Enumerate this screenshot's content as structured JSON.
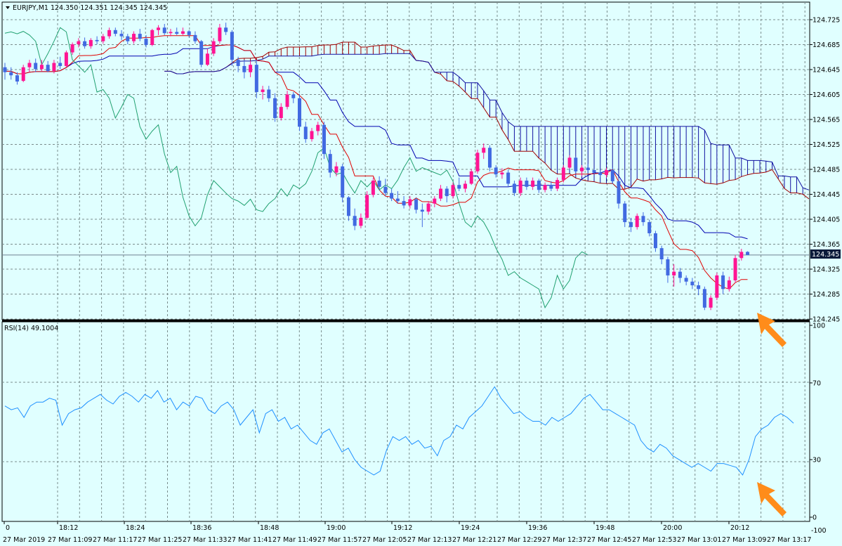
{
  "colors": {
    "background": "#e0ffff",
    "grid": "#7a8c8c",
    "bull": "#ff1493",
    "bear": "#4169e1",
    "tenkan": "#e00000",
    "kijun": "#0000b0",
    "chikou": "#20a070",
    "cloud_bull": "#a00000",
    "cloud_bear": "#1010a0",
    "rsi": "#1e90ff",
    "arrow": "#ff8c1a",
    "bid_line": "#708090"
  },
  "main_chart": {
    "header": "EURJPY,M1  124.350 124.351 124.345 124.345",
    "current_price_label": "124.345",
    "price_ticks": [
      "124.725",
      "124.685",
      "124.645",
      "124.605",
      "124.565",
      "124.525",
      "124.485",
      "124.445",
      "124.405",
      "124.365",
      "124.325",
      "124.285",
      "124.245"
    ]
  },
  "rsi_panel": {
    "header": "RSI(14) 49.1004",
    "levels": [
      "100",
      "70",
      "30",
      "0"
    ],
    "bottom_label": "-100"
  },
  "time_axis": {
    "upper_labels": [
      "0",
      "18:12",
      "18:24",
      "18:36",
      "18:48",
      "19:00",
      "19:12",
      "19:24",
      "19:36",
      "19:48",
      "20:00",
      "20:12"
    ],
    "lower_labels": [
      "27 Mar 2019",
      "27 Mar 11:09",
      "27 Mar 11:17",
      "27 Mar 11:25",
      "27 Mar 11:33",
      "27 Mar 11:41",
      "27 Mar 11:49",
      "27 Mar 11:57",
      "27 Mar 12:05",
      "27 Mar 12:13",
      "27 Mar 12:21",
      "27 Mar 12:29",
      "27 Mar 12:37",
      "27 Mar 12:45",
      "27 Mar 12:53",
      "27 Mar 13:01",
      "27 Mar 13:09",
      "27 Mar 13:17"
    ]
  },
  "chart_data": [
    {
      "type": "candlestick",
      "series": [
        {
          "name": "EURJPY,M1",
          "ohlc": [
            [
              124.648,
              124.655,
              124.628,
              124.64
            ],
            [
              124.64,
              124.648,
              124.628,
              124.635
            ],
            [
              124.635,
              124.64,
              124.62,
              124.625
            ],
            [
              124.626,
              124.652,
              124.624,
              124.648
            ],
            [
              124.648,
              124.66,
              124.64,
              124.655
            ],
            [
              124.655,
              124.662,
              124.64,
              124.645
            ],
            [
              124.645,
              124.66,
              124.642,
              124.652
            ],
            [
              124.652,
              124.658,
              124.64,
              124.642
            ],
            [
              124.642,
              124.66,
              124.638,
              124.655
            ],
            [
              124.655,
              124.665,
              124.645,
              124.65
            ],
            [
              124.65,
              124.675,
              124.648,
              124.672
            ],
            [
              124.672,
              124.688,
              124.668,
              124.685
            ],
            [
              124.685,
              124.695,
              124.68,
              124.69
            ],
            [
              124.69,
              124.696,
              124.678,
              124.682
            ],
            [
              124.682,
              124.695,
              124.678,
              124.692
            ],
            [
              124.692,
              124.698,
              124.685,
              124.69
            ],
            [
              124.69,
              124.702,
              124.686,
              124.698
            ],
            [
              124.698,
              124.712,
              124.694,
              124.708
            ],
            [
              124.708,
              124.712,
              124.698,
              124.702
            ],
            [
              124.702,
              124.708,
              124.692,
              124.698
            ],
            [
              124.698,
              124.702,
              124.685,
              124.69
            ],
            [
              124.69,
              124.706,
              124.686,
              124.702
            ],
            [
              124.702,
              124.71,
              124.69,
              124.694
            ],
            [
              124.694,
              124.7,
              124.68,
              124.684
            ],
            [
              124.684,
              124.71,
              124.682,
              124.708
            ],
            [
              124.708,
              124.716,
              124.7,
              124.712
            ],
            [
              124.712,
              124.718,
              124.7,
              124.703
            ],
            [
              124.703,
              124.71,
              124.698,
              124.705
            ],
            [
              124.705,
              124.712,
              124.7,
              124.702
            ],
            [
              124.702,
              124.712,
              124.7,
              124.706
            ],
            [
              124.706,
              124.708,
              124.696,
              124.7
            ],
            [
              124.7,
              124.706,
              124.686,
              124.69
            ],
            [
              124.69,
              124.692,
              124.648,
              124.652
            ],
            [
              124.652,
              124.678,
              124.65,
              124.67
            ],
            [
              124.67,
              124.695,
              124.666,
              124.69
            ],
            [
              124.69,
              124.718,
              124.686,
              124.712
            ],
            [
              124.712,
              124.72,
              124.7,
              124.705
            ],
            [
              124.705,
              124.708,
              124.65,
              124.66
            ],
            [
              124.66,
              124.665,
              124.64,
              124.65
            ],
            [
              124.65,
              124.66,
              124.63,
              124.64
            ],
            [
              124.64,
              124.658,
              124.632,
              124.652
            ],
            [
              124.652,
              124.66,
              124.598,
              124.608
            ],
            [
              124.608,
              124.618,
              124.596,
              124.612
            ],
            [
              124.612,
              124.618,
              124.592,
              124.598
            ],
            [
              124.598,
              124.606,
              124.56,
              124.566
            ],
            [
              124.566,
              124.59,
              124.562,
              124.584
            ],
            [
              124.584,
              124.61,
              124.58,
              124.604
            ],
            [
              124.604,
              124.608,
              124.59,
              124.598
            ],
            [
              124.598,
              124.605,
              124.545,
              124.552
            ],
            [
              124.552,
              124.56,
              124.526,
              124.532
            ],
            [
              124.532,
              124.55,
              124.528,
              124.545
            ],
            [
              124.545,
              124.56,
              124.538,
              124.555
            ],
            [
              124.555,
              124.56,
              124.5,
              124.508
            ],
            [
              124.508,
              124.515,
              124.47,
              124.478
            ],
            [
              124.478,
              124.495,
              124.472,
              124.488
            ],
            [
              124.488,
              124.492,
              124.43,
              124.438
            ],
            [
              124.438,
              124.44,
              124.4,
              124.408
            ],
            [
              124.408,
              124.42,
              124.385,
              124.392
            ],
            [
              124.392,
              124.412,
              124.388,
              124.405
            ],
            [
              124.405,
              124.448,
              124.402,
              124.442
            ],
            [
              124.442,
              124.47,
              124.438,
              124.465
            ],
            [
              124.465,
              124.472,
              124.45,
              124.455
            ],
            [
              124.455,
              124.468,
              124.44,
              124.445
            ],
            [
              124.445,
              124.452,
              124.432,
              124.436
            ],
            [
              124.436,
              124.448,
              124.428,
              124.432
            ],
            [
              124.432,
              124.44,
              124.42,
              124.425
            ],
            [
              124.425,
              124.44,
              124.42,
              124.435
            ],
            [
              124.435,
              124.438,
              124.412,
              124.418
            ],
            [
              124.418,
              124.428,
              124.39,
              124.415
            ],
            [
              124.415,
              124.432,
              124.41,
              124.428
            ],
            [
              124.428,
              124.44,
              124.422,
              124.436
            ],
            [
              124.436,
              124.458,
              124.432,
              124.452
            ],
            [
              124.452,
              124.456,
              124.43,
              124.44
            ],
            [
              124.44,
              124.462,
              124.436,
              124.458
            ],
            [
              124.458,
              124.47,
              124.448,
              124.452
            ],
            [
              124.452,
              124.465,
              124.446,
              124.46
            ],
            [
              124.46,
              124.484,
              124.458,
              124.48
            ],
            [
              124.48,
              124.515,
              124.476,
              124.51
            ],
            [
              124.51,
              124.525,
              124.5,
              124.518
            ],
            [
              124.518,
              124.522,
              124.48,
              124.486
            ],
            [
              124.486,
              124.49,
              124.47,
              124.475
            ],
            [
              124.475,
              124.485,
              124.468,
              124.478
            ],
            [
              124.478,
              124.482,
              124.455,
              124.46
            ],
            [
              124.46,
              124.465,
              124.44,
              124.445
            ],
            [
              124.445,
              124.47,
              124.44,
              124.465
            ],
            [
              124.465,
              124.47,
              124.45,
              124.455
            ],
            [
              124.455,
              124.47,
              124.45,
              124.465
            ],
            [
              124.465,
              124.468,
              124.445,
              124.45
            ],
            [
              124.45,
              124.462,
              124.446,
              124.458
            ],
            [
              124.458,
              124.464,
              124.448,
              124.452
            ],
            [
              124.452,
              124.47,
              124.448,
              124.466
            ],
            [
              124.466,
              124.49,
              124.462,
              124.486
            ],
            [
              124.486,
              124.506,
              124.484,
              124.502
            ],
            [
              124.502,
              124.504,
              124.476,
              124.48
            ],
            [
              124.48,
              124.49,
              124.472,
              124.486
            ],
            [
              124.486,
              124.492,
              124.476,
              124.482
            ],
            [
              124.482,
              124.484,
              124.476,
              124.478
            ],
            [
              124.478,
              124.482,
              124.47,
              124.474
            ],
            [
              124.474,
              124.486,
              124.47,
              124.482
            ],
            [
              124.482,
              124.486,
              124.46,
              124.464
            ],
            [
              124.464,
              124.47,
              124.42,
              124.428
            ],
            [
              124.428,
              124.432,
              124.39,
              124.398
            ],
            [
              124.398,
              124.405,
              124.382,
              124.39
            ],
            [
              124.39,
              124.412,
              124.386,
              124.408
            ],
            [
              124.408,
              124.414,
              124.392,
              124.398
            ],
            [
              124.398,
              124.402,
              124.375,
              124.38
            ],
            [
              124.38,
              124.384,
              124.35,
              124.356
            ],
            [
              124.356,
              124.36,
              124.33,
              124.338
            ],
            [
              124.338,
              124.342,
              124.3,
              124.312
            ],
            [
              124.312,
              124.33,
              124.294,
              124.318
            ],
            [
              124.318,
              124.324,
              124.3,
              124.308
            ],
            [
              124.308,
              124.312,
              124.296,
              124.302
            ],
            [
              124.302,
              124.308,
              124.29,
              124.296
            ],
            [
              124.296,
              124.302,
              124.28,
              124.29
            ],
            [
              124.29,
              124.294,
              124.256,
              124.26
            ],
            [
              124.26,
              124.28,
              124.256,
              124.276
            ],
            [
              124.276,
              124.316,
              124.272,
              124.312
            ],
            [
              124.312,
              124.318,
              124.282,
              124.29
            ],
            [
              124.29,
              124.31,
              124.286,
              124.304
            ],
            [
              124.304,
              124.345,
              124.3,
              124.34
            ],
            [
              124.34,
              124.355,
              124.336,
              124.35
            ],
            [
              124.35,
              124.351,
              124.345,
              124.345
            ]
          ]
        }
      ],
      "ylim": [
        124.245,
        124.735
      ]
    },
    {
      "type": "line",
      "title": "RSI(14) 49.1004",
      "series": [
        {
          "name": "RSI(14)",
          "values": [
            58,
            56,
            57,
            52,
            58,
            60,
            60,
            62,
            61,
            48,
            54,
            56,
            57,
            60,
            62,
            64,
            61,
            59,
            63,
            65,
            63,
            60,
            64,
            62,
            66,
            60,
            62,
            56,
            60,
            58,
            63,
            62,
            56,
            54,
            58,
            60,
            56,
            48,
            52,
            56,
            44,
            54,
            56,
            50,
            52,
            46,
            48,
            44,
            40,
            38,
            44,
            46,
            40,
            34,
            36,
            30,
            26,
            24,
            22,
            24,
            35,
            42,
            40,
            42,
            38,
            40,
            36,
            37,
            32,
            40,
            42,
            48,
            46,
            52,
            55,
            58,
            63,
            68,
            62,
            58,
            54,
            55,
            52,
            50,
            50,
            48,
            52,
            50,
            52,
            54,
            58,
            62,
            64,
            60,
            56,
            56,
            54,
            52,
            50,
            48,
            40,
            36,
            34,
            38,
            36,
            32,
            30,
            28,
            26,
            28,
            26,
            24,
            28,
            28,
            27,
            26,
            22,
            30,
            42,
            46,
            48,
            52,
            54,
            52,
            49
          ]
        }
      ],
      "levels": [
        100,
        70,
        30,
        0
      ],
      "ylim": [
        0,
        100
      ]
    }
  ]
}
